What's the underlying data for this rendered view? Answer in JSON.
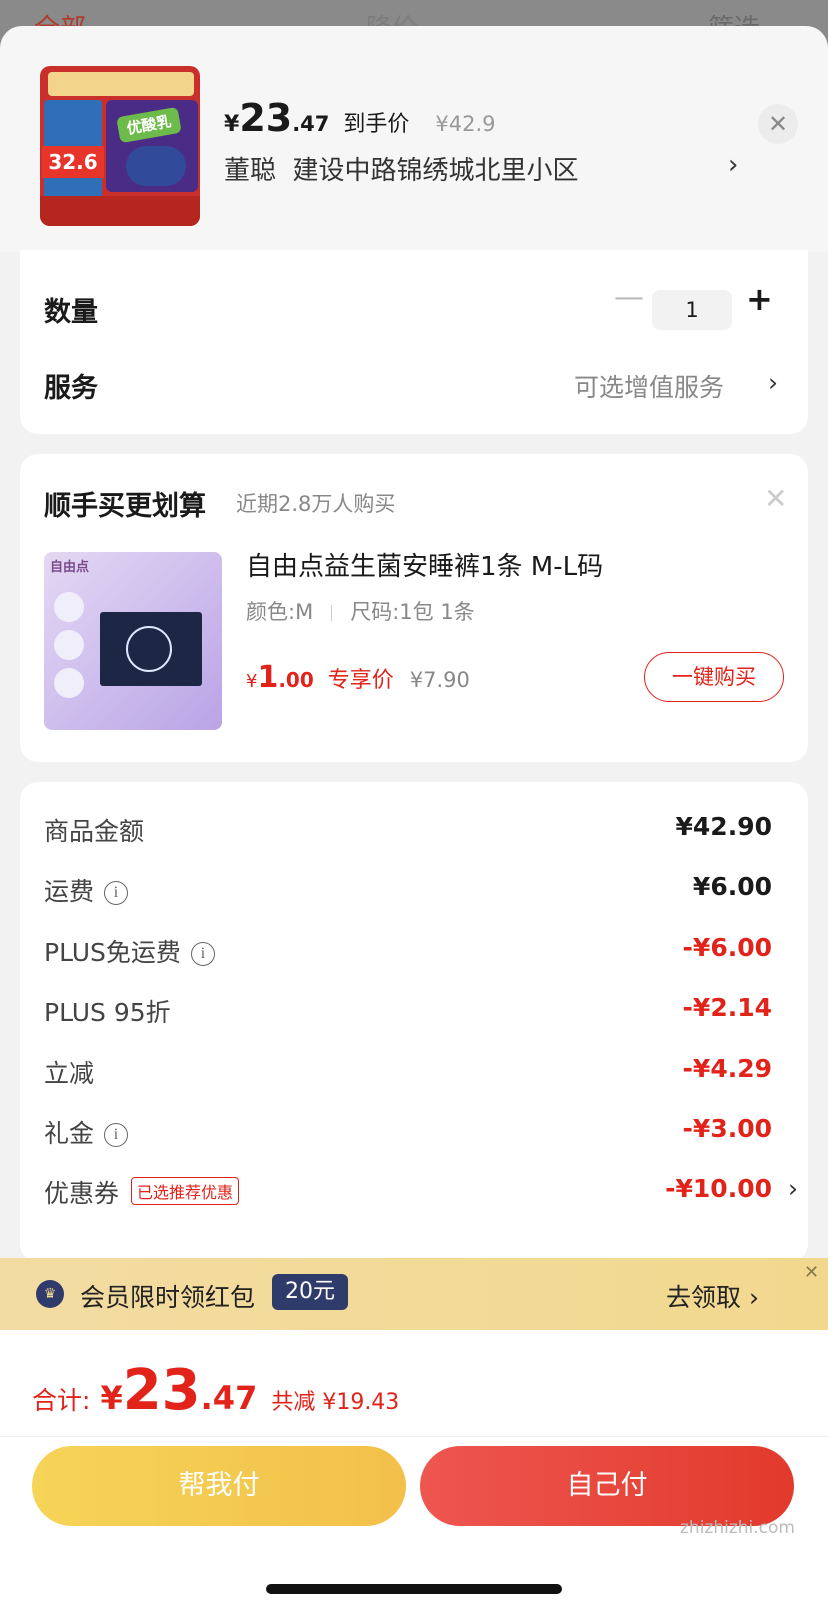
{
  "background_page": {
    "tab_all": "全部",
    "tab_price": "降价",
    "filter": "筛选"
  },
  "header": {
    "price_yen": "¥",
    "price_int": "23",
    "price_dec": ".47",
    "price_tag": "到手价",
    "orig_price": "¥42.9",
    "recipient": "董聪",
    "address": "建设中路锦绣城北里小区",
    "thumb_badge": "32.6",
    "thumb_label": "优酸乳"
  },
  "quantity": {
    "label": "数量",
    "value": "1"
  },
  "service": {
    "label": "服务",
    "value": "可选增值服务"
  },
  "addon": {
    "title": "顺手买更划算",
    "note": "近期2.8万人购买",
    "product_name": "自由点益生菌安睡裤1条 M-L码",
    "spec_color": "颜色:M",
    "spec_size": "尺码:1包 1条",
    "price_yen": "¥",
    "price_int": "1",
    "price_dec": ".00",
    "price_tag": "专享价",
    "orig_price": "¥7.90",
    "buy_label": "一键购买",
    "brand_logo": "自由点"
  },
  "summary": {
    "rows": [
      {
        "label": "商品金额",
        "value": "¥42.90"
      },
      {
        "label": "运费",
        "value": "¥6.00"
      },
      {
        "label": "PLUS免运费",
        "value": "-¥6.00"
      },
      {
        "label": "PLUS 95折",
        "value": "-¥2.14"
      },
      {
        "label": "立减",
        "value": "-¥4.29"
      },
      {
        "label": "礼金",
        "value": "-¥3.00"
      },
      {
        "label": "优惠券",
        "badge": "已选推荐优惠",
        "value": "-¥10.00"
      }
    ]
  },
  "banner": {
    "text": "会员限时领红包",
    "badge": "20元",
    "cta": "去领取"
  },
  "footer": {
    "total_label": "合计:",
    "total_yen": "¥",
    "total_int": "23",
    "total_dec": ".47",
    "total_save": "共减 ¥19.43",
    "help_pay": "帮我付",
    "self_pay": "自己付",
    "watermark": "zhizhizhi.com"
  },
  "colors": {
    "accent_red": "#e2231a",
    "gold": "#f3c04a",
    "navy": "#2f3b6a"
  }
}
